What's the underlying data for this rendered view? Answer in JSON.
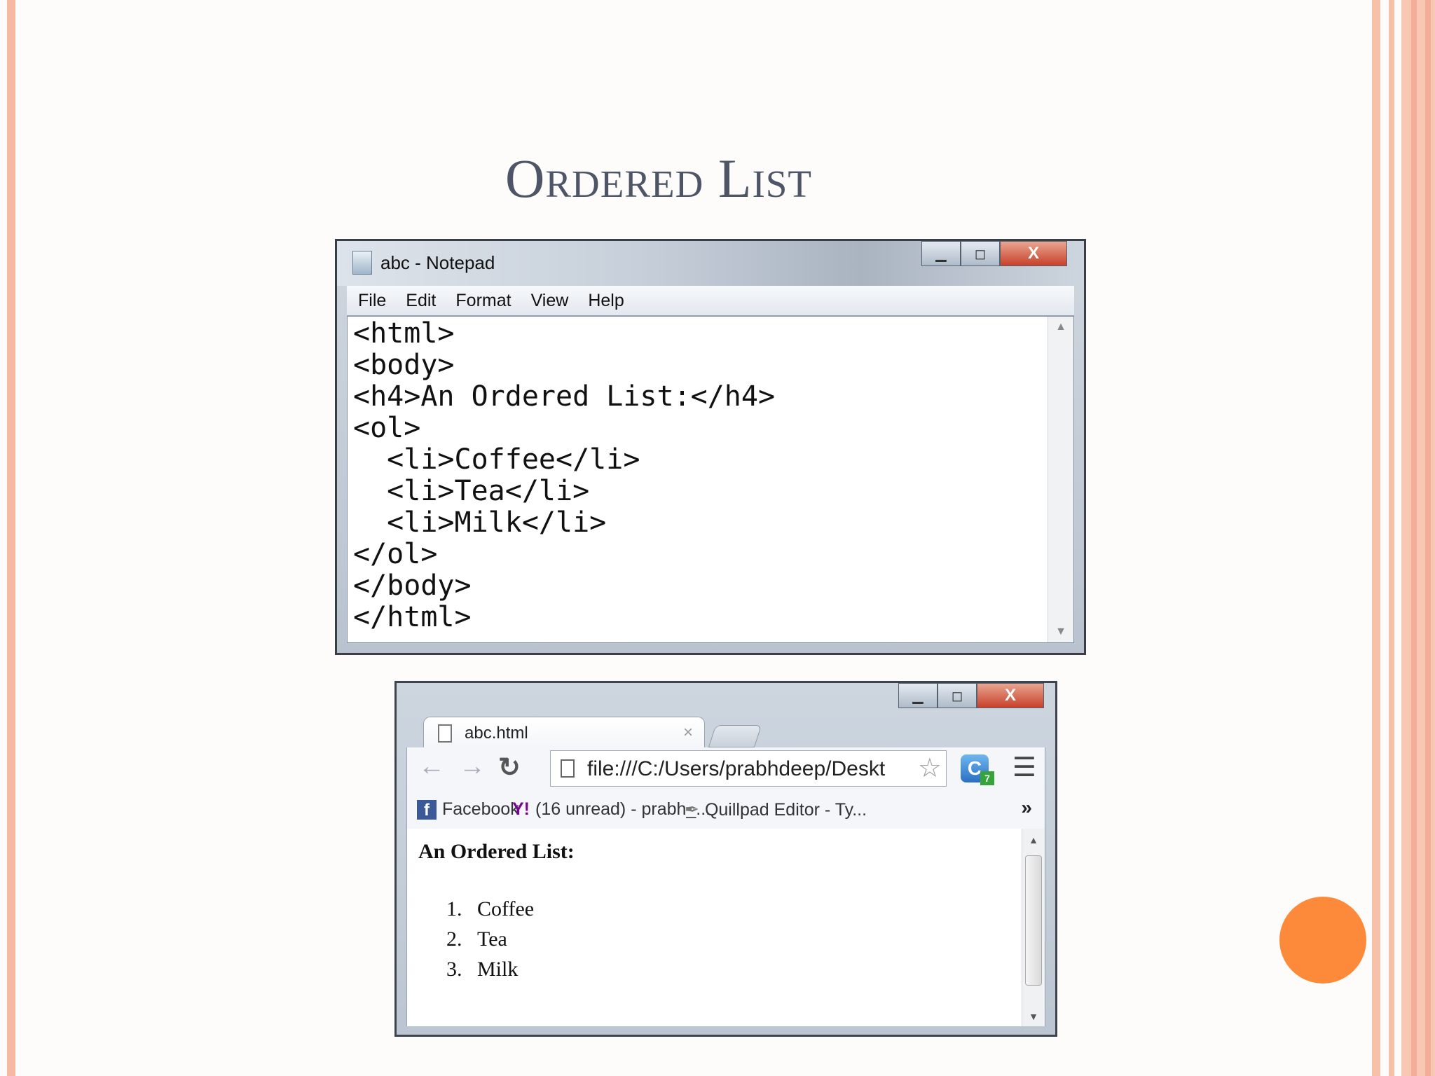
{
  "slide": {
    "title": "Ordered List"
  },
  "notepad": {
    "title": "abc - Notepad",
    "menu": [
      "File",
      "Edit",
      "Format",
      "View",
      "Help"
    ],
    "code_lines": [
      "<html>",
      "<body>",
      "<h4>An Ordered List:</h4>",
      "<ol>",
      "  <li>Coffee</li>",
      "  <li>Tea</li>",
      "  <li>Milk</li>",
      "</ol>",
      "</body>",
      "</html>"
    ],
    "buttons": {
      "minimize": "▁",
      "maximize": "◻",
      "close": "X"
    }
  },
  "browser": {
    "tab_title": "abc.html",
    "tab_close": "×",
    "address": "file:///C:/Users/prabhdeep/Deskt",
    "extension_badge": "7",
    "extension_letter": "C",
    "bookmarks": {
      "facebook": "Facebook",
      "yahoo": "(16 unread) - prabh_...",
      "quillpad": "Quillpad Editor - Ty...",
      "more": "»"
    },
    "page": {
      "heading": "An Ordered List:",
      "items": [
        {
          "num": "1.",
          "text": "Coffee"
        },
        {
          "num": "2.",
          "text": "Tea"
        },
        {
          "num": "3.",
          "text": "Milk"
        }
      ]
    },
    "buttons": {
      "minimize": "▁",
      "maximize": "◻",
      "close": "X"
    }
  },
  "colors": {
    "accent_circle": "#fd8a3a",
    "slide_border": "#f6b9a4"
  }
}
